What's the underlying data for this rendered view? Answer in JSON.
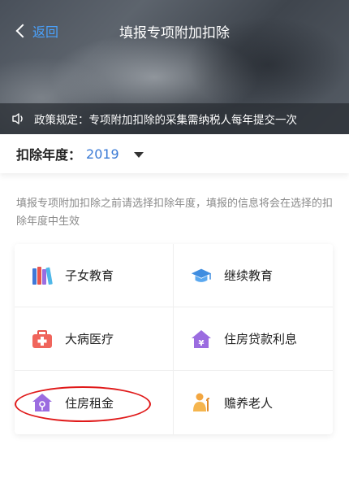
{
  "nav": {
    "back_label": "返回",
    "title": "填报专项附加扣除"
  },
  "notice": {
    "text": "政策规定：专项附加扣除的采集需纳税人每年提交一次"
  },
  "year": {
    "label": "扣除年度：",
    "value": "2019"
  },
  "hint": {
    "text": "填报专项附加扣除之前请选择扣除年度，填报的信息将会在选择的扣除年度中生效"
  },
  "items": [
    {
      "label": "子女教育",
      "icon": "books-icon"
    },
    {
      "label": "继续教育",
      "icon": "graduation-cap-icon"
    },
    {
      "label": "大病医疗",
      "icon": "medical-kit-icon"
    },
    {
      "label": "住房贷款利息",
      "icon": "house-yen-icon"
    },
    {
      "label": "住房租金",
      "icon": "house-key-icon"
    },
    {
      "label": "赡养老人",
      "icon": "elderly-person-icon"
    }
  ],
  "colors": {
    "accent": "#3a7ad5",
    "back_link": "#4aa3ff",
    "highlight": "#e01a1a"
  }
}
